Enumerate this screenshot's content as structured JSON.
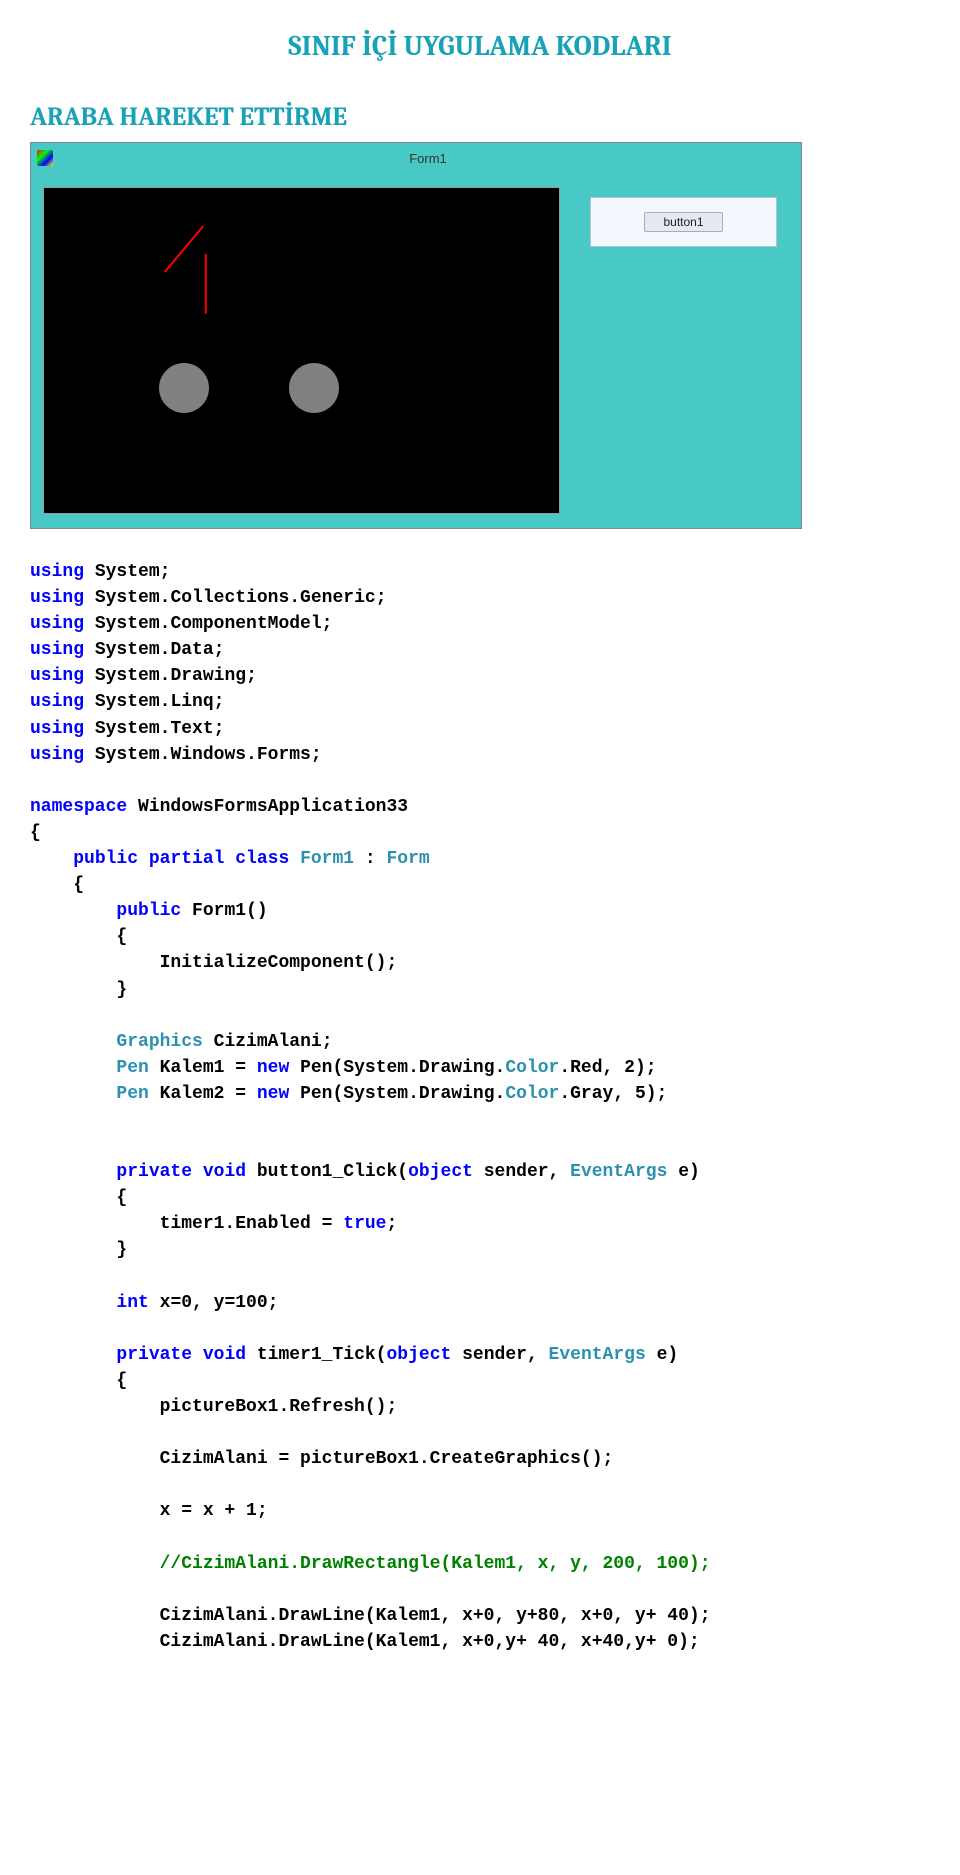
{
  "doc": {
    "title_main": "SINIF İÇİ UYGULAMA KODLARI",
    "title_sub": "ARABA HAREKET ETTİRME"
  },
  "winform": {
    "title": "Form1",
    "button_label": "button1"
  },
  "code": {
    "usings": [
      "System",
      "System.Collections.Generic",
      "System.ComponentModel",
      "System.Data",
      "System.Drawing",
      "System.Linq",
      "System.Text",
      "System.Windows.Forms"
    ],
    "namespace": "WindowsFormsApplication33",
    "class_decl": "Form1",
    "base_class": "Form",
    "ctor": "Form1",
    "init_call": "InitializeComponent();",
    "gfx_decl": "CizimAlani",
    "pen1_name": "Kalem1",
    "pen1_expr_a": "Pen(System.Drawing.",
    "pen1_color": "Color",
    "pen1_expr_b": ".Red, 2);",
    "pen2_name": "Kalem2",
    "pen2_expr_a": "Pen(System.Drawing.",
    "pen2_color": "Color",
    "pen2_expr_b": ".Gray, 5);",
    "btn_handler": "button1_Click",
    "btn_arg1": "sender",
    "btn_arg2": "e",
    "timer_enable": "timer1.Enabled = ",
    "timer_true": "true",
    "xy_decl": "x=0, y=100;",
    "tick_handler": "timer1_Tick",
    "tick_line1": "pictureBox1.Refresh();",
    "tick_line2": "CizimAlani = pictureBox1.CreateGraphics();",
    "tick_line3": "x = x + 1;",
    "tick_comment": "//CizimAlani.DrawRectangle(Kalem1, x, y, 200, 100);",
    "tick_line4": "CizimAlani.DrawLine(Kalem1, x+0, y+80, x+0, y+ 40);",
    "tick_line5": "CizimAlani.DrawLine(Kalem1, x+0,y+ 40, x+40,y+ 0);"
  }
}
